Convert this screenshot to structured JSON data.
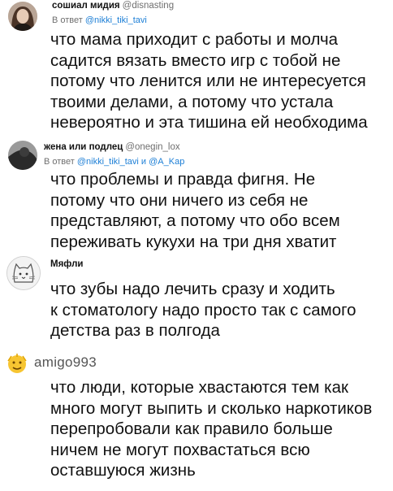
{
  "posts": [
    {
      "author": "сошиал мидия",
      "handle": "@disnasting",
      "reply_prefix": "В ответ",
      "reply_to": "@nikki_tiki_tavi",
      "avatar_icon": "woman-portrait-avatar",
      "lines": [
        "что мама приходит с работы и молча",
        "садится вязать вместо игр с тобой не",
        "потому что ленится или не интересуется",
        "твоими делами, а потому что устала",
        "невероятно и эта тишина ей необходима"
      ]
    },
    {
      "author": "жена или подлец",
      "handle": "@onegin_lox",
      "reply_prefix": "В ответ",
      "reply_to": "@nikki_tiki_tavi и @A_Kap",
      "avatar_icon": "dark-photo-avatar",
      "lines": [
        "что проблемы и правда фигня. Не",
        "потому что они ничего из себя не",
        "представляют, а потому что обо всем",
        "переживать кукухи на три дня хватит"
      ]
    },
    {
      "author": "Мяфли",
      "avatar_icon": "cat-sketch-avatar",
      "lines": [
        "что зубы надо лечить сразу и ходить",
        "к стоматологу надо просто так с самого",
        "детства раз в полгода"
      ]
    },
    {
      "author": "amigo993",
      "avatar_icon": "yellow-emoji-avatar",
      "lines": [
        "что люди, которые хвастаются тем как",
        "много могут выпить и сколько наркотиков",
        "перепробовали как правило больше",
        "ничем не могут похвастаться всю",
        "оставшуюся жизнь"
      ]
    }
  ]
}
